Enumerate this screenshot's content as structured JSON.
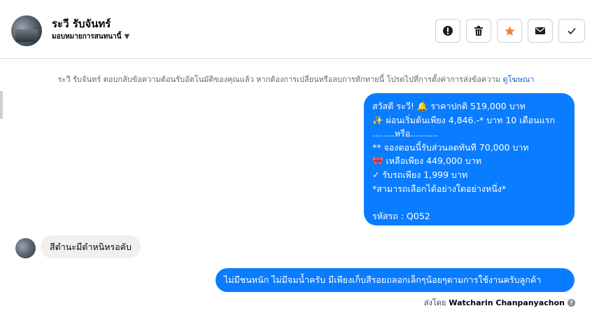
{
  "header": {
    "name": "ระวี รับจันทร์",
    "assign_label": "มอบหมายการสนทนานี้",
    "actions": [
      {
        "icon": "alert-icon"
      },
      {
        "icon": "trash-icon"
      },
      {
        "icon": "star-icon",
        "color": "#f5832f"
      },
      {
        "icon": "mail-icon"
      },
      {
        "icon": "check-icon"
      }
    ]
  },
  "notice": {
    "text": "ระวี รับจันทร์ ตอบกลับข้อความต้อนรับอัตโนมัติของคุณแล้ว หากต้องการเปลี่ยนหรือลบการทักทายนี้ โปรดไปที่การตั้งค่าการส่งข้อความ ",
    "link": "ดูโฆษณา"
  },
  "messages": {
    "outgoing_1": "สวัสดี ระวี! 🔔  ราคาปกติ 519,000 บาท\n✨  ผ่อนเริ่มต้นเพียง 4,846.-* บาท 10 เดือนแรก\n........หรือ..........\n** จองตอนนี้รับส่วนลดทันที 70,000 บาท\n🎀  เหลือเพียง 449,000 บาท\n✓ รับรถเพียง 1,999 บาท\n*สามารถเลือกได้อย่างใดอย่างหนึ่ง*\n\n รหัสรถ : Q052",
    "incoming_1": "สีตำนะมีตำหนิหรอคับ",
    "outgoing_2": "ไม่มีชนหนัก ไม่มีจมน้ำครับ มีเพียงเก็บสีรอยถลอกเล็กๆน้อยๆตามการใช้งานครับลูกค้า"
  },
  "sent_by": {
    "prefix": "ส่งโดย",
    "name": "Watcharin Chanpanyachon",
    "help_icon": "?"
  },
  "colors": {
    "outgoing_bubble": "#0a7cff",
    "incoming_bubble": "#f0f0f0",
    "link": "#1a62c4"
  }
}
